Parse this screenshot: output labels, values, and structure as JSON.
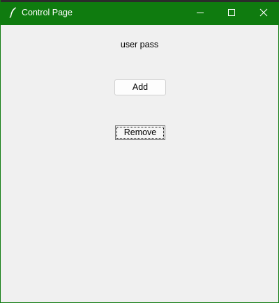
{
  "window": {
    "title": "Control Page",
    "accent_color": "#0f7b0f",
    "icon": "feather-icon",
    "controls": {
      "minimize_icon": "minimize-icon",
      "maximize_icon": "maximize-icon",
      "close_icon": "close-icon"
    }
  },
  "main": {
    "user_label": "user pass",
    "add_label": "Add",
    "remove_label": "Remove"
  }
}
